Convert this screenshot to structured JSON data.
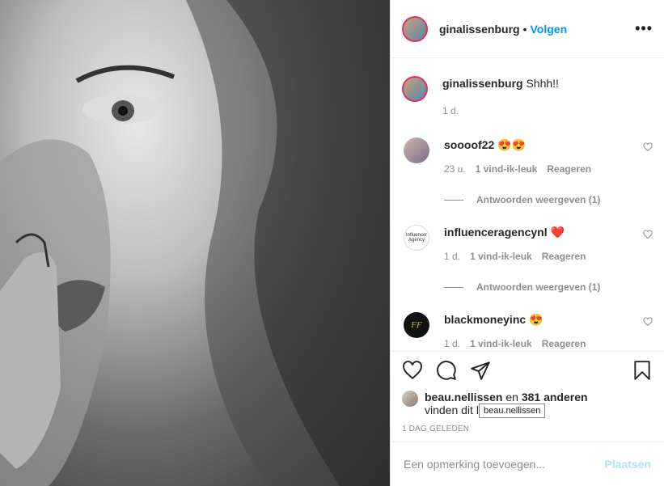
{
  "post": {
    "author": "ginalissenburg",
    "separator": "•",
    "follow_label": "Volgen",
    "more_label": "•••",
    "caption": "Shhh!!",
    "caption_time": "1 d."
  },
  "comments": [
    {
      "user": "soooof22",
      "text": "😍😍",
      "time": "23 u.",
      "likes": "1 vind-ik-leuk",
      "reply": "Reageren",
      "view_replies": "Antwoorden weergeven (1)"
    },
    {
      "user": "influenceragencynl",
      "text": "❤️",
      "time": "1 d.",
      "likes": "1 vind-ik-leuk",
      "reply": "Reageren",
      "view_replies": "Antwoorden weergeven (1)",
      "avatar_text": "Influencer Agency"
    },
    {
      "user": "blackmoneyinc",
      "text": "😍",
      "time": "1 d.",
      "likes": "1 vind-ik-leuk",
      "reply": "Reageren",
      "avatar_text": "FF"
    }
  ],
  "likes": {
    "first_user": "beau.nellissen",
    "connector": "en",
    "others": "381 anderen",
    "suffix": "vinden dit leuk",
    "tooltip": "beau.nellissen"
  },
  "timestamp": "1 DAG GELEDEN",
  "add_comment": {
    "placeholder": "Een opmerking toevoegen...",
    "post_label": "Plaatsen"
  },
  "colors": {
    "link": "#0095f6",
    "muted": "#8e8e8e",
    "post_disabled": "#b2dffc"
  },
  "icons": [
    "heart-icon",
    "comment-icon",
    "share-icon",
    "bookmark-icon"
  ]
}
